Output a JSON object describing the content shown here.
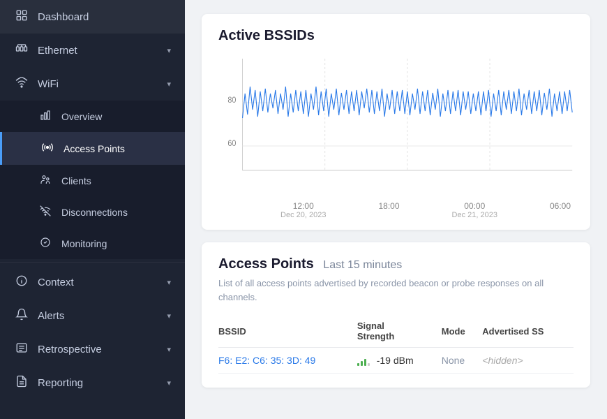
{
  "sidebar": {
    "items": [
      {
        "id": "dashboard",
        "label": "Dashboard",
        "icon": "grid",
        "active": false,
        "expandable": false
      },
      {
        "id": "ethernet",
        "label": "Ethernet",
        "icon": "ethernet",
        "active": false,
        "expandable": true
      },
      {
        "id": "wifi",
        "label": "WiFi",
        "icon": "wifi",
        "active": false,
        "expandable": true,
        "expanded": true
      },
      {
        "id": "overview",
        "label": "Overview",
        "icon": "chart",
        "active": false,
        "sub": true
      },
      {
        "id": "access-points",
        "label": "Access Points",
        "icon": "ap",
        "active": true,
        "sub": true
      },
      {
        "id": "clients",
        "label": "Clients",
        "icon": "clients",
        "active": false,
        "sub": true
      },
      {
        "id": "disconnections",
        "label": "Disconnections",
        "icon": "disconnections",
        "active": false,
        "sub": true
      },
      {
        "id": "monitoring",
        "label": "Monitoring",
        "icon": "monitoring",
        "active": false,
        "sub": true
      },
      {
        "id": "context",
        "label": "Context",
        "icon": "info",
        "active": false,
        "expandable": true
      },
      {
        "id": "alerts",
        "label": "Alerts",
        "icon": "bell",
        "active": false,
        "expandable": true
      },
      {
        "id": "retrospective",
        "label": "Retrospective",
        "icon": "list",
        "active": false,
        "expandable": true
      },
      {
        "id": "reporting",
        "label": "Reporting",
        "icon": "reporting",
        "active": false,
        "expandable": true
      }
    ]
  },
  "main": {
    "chart": {
      "title": "Active BSSIDs",
      "y_labels": [
        "80",
        "60"
      ],
      "x_labels": [
        {
          "time": "12:00",
          "date": "Dec 20, 2023"
        },
        {
          "time": "18:00",
          "date": ""
        },
        {
          "time": "00:00",
          "date": "Dec 21, 2023"
        },
        {
          "time": "06:00",
          "date": ""
        }
      ]
    },
    "access_points": {
      "title": "Access Points",
      "subtitle": "Last 15 minutes",
      "description": "List of all access points advertised by recorded beacon or probe responses on all channels.",
      "columns": [
        "BSSID",
        "Signal\nStrength",
        "Mode",
        "Advertised SS"
      ],
      "rows": [
        {
          "bssid": "F6: E2: C6: 35: 3D: 49",
          "signal_value": "-19 dBm",
          "mode": "None",
          "advertised_ss": "<hidden>"
        }
      ]
    }
  }
}
